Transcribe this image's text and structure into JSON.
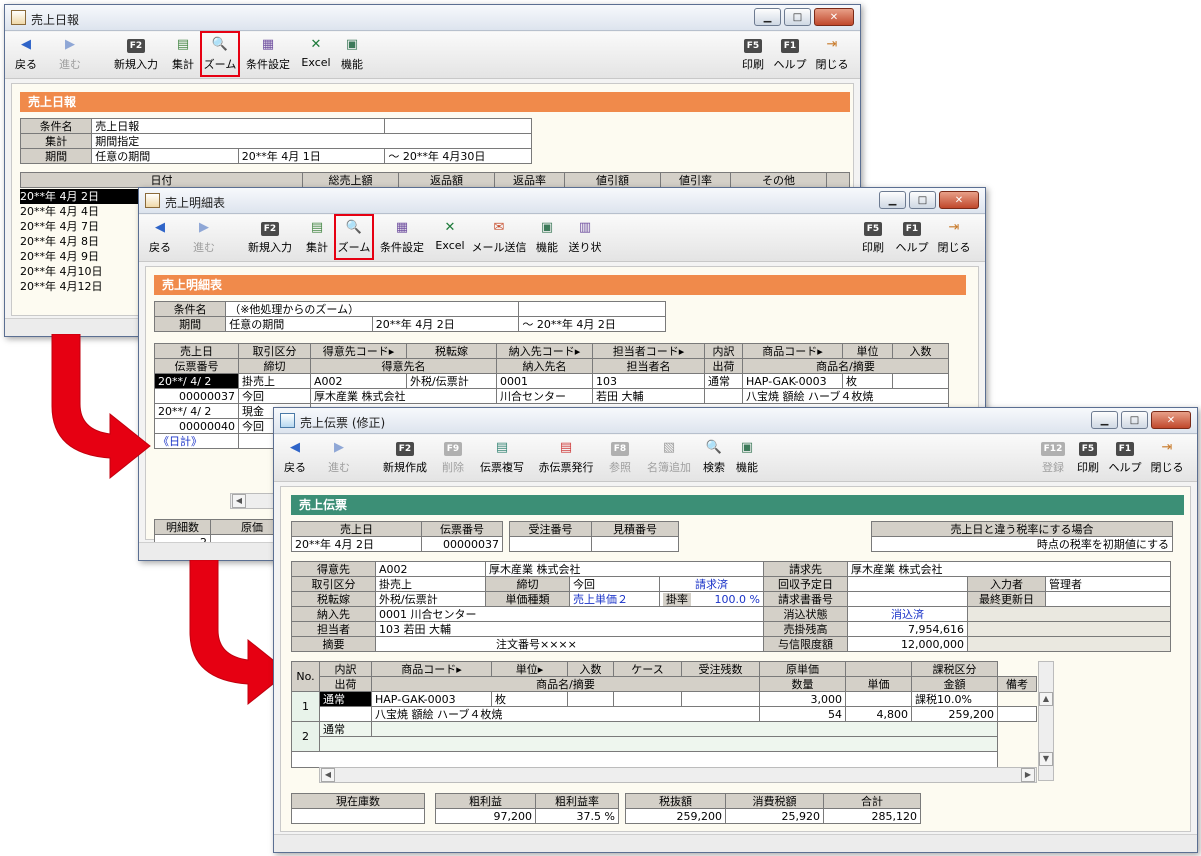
{
  "accent_red": "#e60012",
  "accent_orange": "#f08a4b",
  "accent_green": "#3c8f76",
  "win1": {
    "title": "売上日報",
    "toolbar": [
      {
        "label": "戻る",
        "icon": "◀",
        "key": ""
      },
      {
        "label": "進む",
        "icon": "▶",
        "key": ""
      },
      {
        "label": "新規入力",
        "icon": "",
        "key": "F2"
      },
      {
        "label": "集計",
        "icon": "▤",
        "key": ""
      },
      {
        "label": "ズーム",
        "icon": "🔍",
        "key": ""
      },
      {
        "label": "条件設定",
        "icon": "▦",
        "key": ""
      },
      {
        "label": "Excel",
        "icon": "✕",
        "key": ""
      },
      {
        "label": "機能",
        "icon": "▣",
        "key": ""
      },
      {
        "label": "印刷",
        "icon": "",
        "key": "F5"
      },
      {
        "label": "ヘルプ",
        "icon": "",
        "key": "F1"
      },
      {
        "label": "閉じる",
        "icon": "⇥",
        "key": ""
      }
    ],
    "band": "売上日報",
    "cond": {
      "l1": "条件名",
      "v1": "売上日報",
      "l2": "集計",
      "v2": "期間指定",
      "l3": "期間",
      "v3": "任意の期間",
      "from": "20**年  4月  1日",
      "tilde": "～",
      "to": "20**年  4月30日"
    },
    "grid_headers": [
      "日付",
      "総売上額",
      "返品額",
      "返品率",
      "値引額",
      "値引率",
      "その他"
    ],
    "dates": [
      "20**年  4月  2日",
      "20**年  4月  4日",
      "20**年  4月  7日",
      "20**年  4月  8日",
      "20**年  4月  9日",
      "20**年  4月10日",
      "20**年  4月12日"
    ],
    "more": "《"
  },
  "win2": {
    "title": "売上明細表",
    "toolbar": [
      {
        "label": "戻る",
        "icon": "◀",
        "key": ""
      },
      {
        "label": "進む",
        "icon": "▶",
        "key": ""
      },
      {
        "label": "新規入力",
        "icon": "",
        "key": "F2"
      },
      {
        "label": "集計",
        "icon": "▤",
        "key": ""
      },
      {
        "label": "ズーム",
        "icon": "🔍",
        "key": ""
      },
      {
        "label": "条件設定",
        "icon": "▦",
        "key": ""
      },
      {
        "label": "Excel",
        "icon": "✕",
        "key": ""
      },
      {
        "label": "メール送信",
        "icon": "✉",
        "key": ""
      },
      {
        "label": "機能",
        "icon": "▣",
        "key": ""
      },
      {
        "label": "送り状",
        "icon": "▥",
        "key": ""
      },
      {
        "label": "印刷",
        "icon": "",
        "key": "F5"
      },
      {
        "label": "ヘルプ",
        "icon": "",
        "key": "F1"
      },
      {
        "label": "閉じる",
        "icon": "⇥",
        "key": ""
      }
    ],
    "band": "売上明細表",
    "cond": {
      "l1": "条件名",
      "v1": "（※他処理からのズーム）",
      "l2": "期間",
      "v2": "任意の期間",
      "from": "20**年  4月  2日",
      "tilde": "～",
      "to": "20**年  4月  2日"
    },
    "h1": [
      "売上日",
      "取引区分",
      "得意先コード▸",
      "税転嫁",
      "納入先コード▸",
      "担当者コード▸",
      "内訳",
      "商品コード▸",
      "単位",
      "入数"
    ],
    "h2": [
      "伝票番号",
      "締切",
      "得意先名",
      "納入先名",
      "担当者名",
      "出荷",
      "商品名/摘要"
    ],
    "r1a": [
      "20**/ 4/ 2",
      "掛売上",
      "A002",
      "外税/伝票計",
      "0001",
      "103",
      "通常",
      "HAP-GAK-0003",
      "枚"
    ],
    "r1b": [
      "00000037",
      "今回",
      "厚木産業  株式会社",
      "川合センター",
      "若田  大輔",
      "八宝焼  額絵  ハーブ４枚焼"
    ],
    "r2a": [
      "20**/ 4/ 2",
      "現金"
    ],
    "r2b": [
      "00000040",
      "今回"
    ],
    "daily": "《日計》",
    "foot_l1": "明細数",
    "foot_v1": "2",
    "foot_l2": "原価"
  },
  "win3": {
    "title": "売上伝票 (修正)",
    "toolbar": [
      {
        "label": "戻る",
        "icon": "◀",
        "key": "",
        "dis": false
      },
      {
        "label": "進む",
        "icon": "▶",
        "key": "",
        "dis": true
      },
      {
        "label": "新規作成",
        "icon": "",
        "key": "F2",
        "dis": false
      },
      {
        "label": "削除",
        "icon": "",
        "key": "F9",
        "dis": true
      },
      {
        "label": "伝票複写",
        "icon": "▤",
        "key": "",
        "dis": false
      },
      {
        "label": "赤伝票発行",
        "icon": "▤",
        "key": "",
        "dis": false
      },
      {
        "label": "参照",
        "icon": "",
        "key": "F8",
        "dis": true
      },
      {
        "label": "名簿追加",
        "icon": "▧",
        "key": "",
        "dis": true
      },
      {
        "label": "検索",
        "icon": "🔍",
        "key": "",
        "dis": false
      },
      {
        "label": "機能",
        "icon": "▣",
        "key": "",
        "dis": false
      },
      {
        "label": "登録",
        "icon": "",
        "key": "F12",
        "dis": true
      },
      {
        "label": "印刷",
        "icon": "",
        "key": "F5",
        "dis": false
      },
      {
        "label": "ヘルプ",
        "icon": "",
        "key": "F1",
        "dis": false
      },
      {
        "label": "閉じる",
        "icon": "⇥",
        "key": "",
        "dis": false
      }
    ],
    "band": "売上伝票",
    "hdr": {
      "l_date": "売上日",
      "v_date": "20**年  4月  2日",
      "l_slip": "伝票番号",
      "v_slip": "00000037",
      "l_order": "受注番号",
      "l_est": "見積番号",
      "note1": "売上日と違う税率にする場合",
      "note2": "時点の税率を初期値にする"
    },
    "info": {
      "l_cust": "得意先",
      "v_cust_code": "A002",
      "v_cust_name": "厚木産業  株式会社",
      "l_bill": "請求先",
      "v_bill": "厚木産業  株式会社",
      "l_trade": "取引区分",
      "v_trade": "掛売上",
      "l_close": "締切",
      "v_close": "今回",
      "v_billed": "請求済",
      "l_collect": "回収予定日",
      "l_inputter": "入力者",
      "v_inputter": "管理者",
      "l_tax": "税転嫁",
      "v_tax": "外税/伝票計",
      "l_ptype": "単価種類",
      "v_ptype": "売上単価２",
      "l_rate": "掛率",
      "v_rate": "100.0 %",
      "l_billno": "請求書番号",
      "l_updated": "最終更新日",
      "l_dest": "納入先",
      "v_dest_code": "0001",
      "v_dest_name": "川合センター",
      "l_consume": "消込状態",
      "v_consume": "消込済",
      "l_staff": "担当者",
      "v_staff_code": "103",
      "v_staff_name": "若田  大輔",
      "l_balance": "売掛残高",
      "v_balance": "7,954,616",
      "l_memo": "摘要",
      "v_memo": "注文番号××××",
      "l_limit": "与信限度額",
      "v_limit": "12,000,000"
    },
    "detail_h1": [
      "No.",
      "内訳",
      "商品コード▸",
      "単位▸",
      "入数",
      "ケース",
      "受注残数",
      "原単価",
      "",
      "課税区分"
    ],
    "detail_h2": [
      "出荷",
      "商品名/摘要",
      "数量",
      "単価",
      "金額",
      "備考"
    ],
    "row1": {
      "no": "1",
      "kind": "通常",
      "code": "HAP-GAK-0003",
      "unit": "枚",
      "cost": "3,000",
      "tax": "課税10.0%",
      "name": "八宝焼  額絵  ハーブ４枚焼",
      "qty": "54",
      "price": "4,800",
      "amount": "259,200"
    },
    "row2": {
      "no": "2",
      "kind": "通常"
    },
    "totals": {
      "l_stock": "現在庫数",
      "l_gp": "粗利益",
      "v_gp": "97,200",
      "l_gpr": "粗利益率",
      "v_gpr": "37.5 %",
      "l_net": "税抜額",
      "v_net": "259,200",
      "l_tax": "消費税額",
      "v_tax": "25,920",
      "l_total": "合計",
      "v_total": "285,120"
    }
  }
}
